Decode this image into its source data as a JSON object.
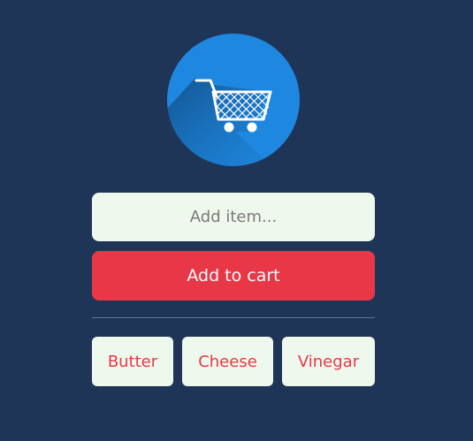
{
  "app": {
    "logo_icon": "shopping-cart-icon",
    "accent_color": "#e83848",
    "background_color": "#1f3558",
    "logo_color": "#1e88e0"
  },
  "input": {
    "placeholder": "Add item...",
    "value": ""
  },
  "add_button": {
    "label": "Add to cart"
  },
  "items": [
    "Butter",
    "Cheese",
    "Vinegar"
  ]
}
